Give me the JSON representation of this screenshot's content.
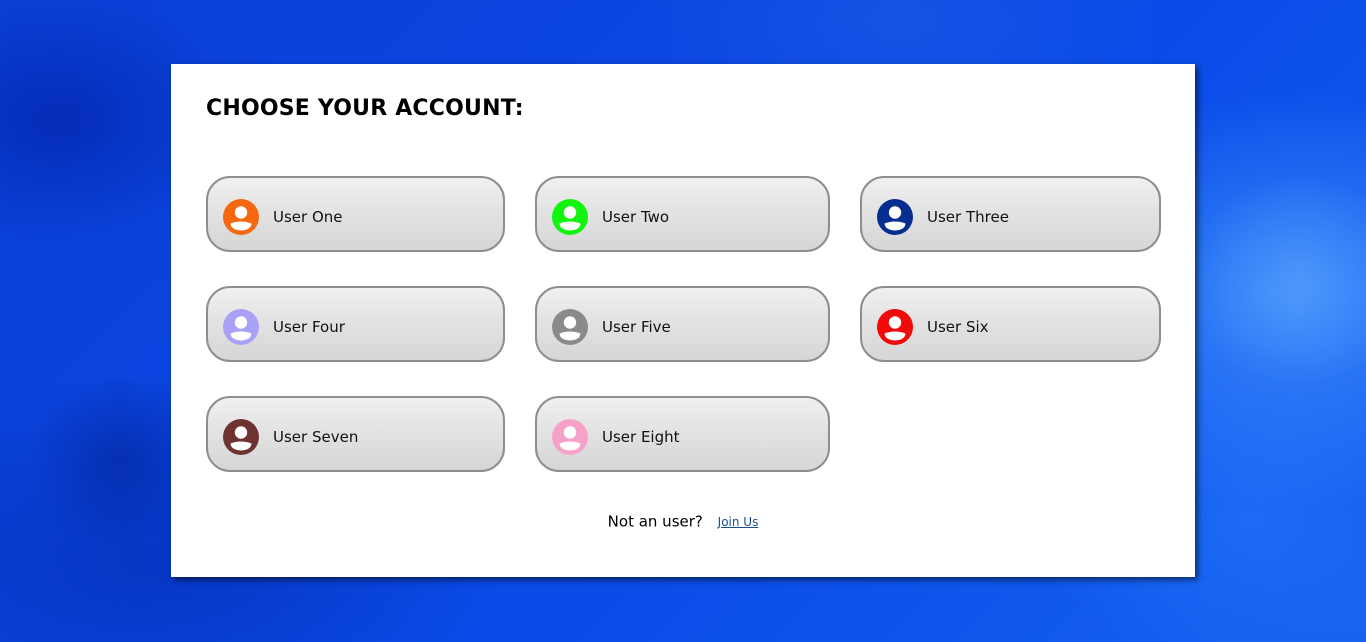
{
  "page": {
    "title": "CHOOSE YOUR ACCOUNT:"
  },
  "users": [
    {
      "label": "User One",
      "icon": "user-avatar-icon",
      "color": "#f5680f"
    },
    {
      "label": "User Two",
      "icon": "user-avatar-icon",
      "color": "#11f50e"
    },
    {
      "label": "User Three",
      "icon": "user-avatar-icon",
      "color": "#062e91"
    },
    {
      "label": "User Four",
      "icon": "user-avatar-icon",
      "color": "#a7a2f5"
    },
    {
      "label": "User Five",
      "icon": "user-avatar-icon",
      "color": "#8a8a8a"
    },
    {
      "label": "User Six",
      "icon": "user-avatar-icon",
      "color": "#f10a0a"
    },
    {
      "label": "User Seven",
      "icon": "user-avatar-icon",
      "color": "#6e3330"
    },
    {
      "label": "User Eight",
      "icon": "user-avatar-icon",
      "color": "#f5a1c8"
    }
  ],
  "footer": {
    "text": "Not an user?",
    "link_label": "Join Us"
  },
  "colors": {
    "background": "#0b47e2",
    "panel": "#ffffff",
    "button_border": "#8e8e8e",
    "link": "#1a4f8f"
  }
}
